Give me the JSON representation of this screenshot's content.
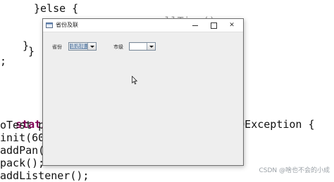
{
  "editor": {
    "lines": [
      {
        "text": "}else {"
      },
      {
        "text": "    ............allTime();"
      },
      {
        "text": "  }"
      },
      {
        "text": "}"
      },
      {
        "text": ";"
      },
      {
        "kw": "static",
        "text": "                            IOException {"
      },
      {
        "text": "oTest p"
      },
      {
        "text": "init(60"
      },
      {
        "text": "addPan("
      },
      {
        "text": "pack();"
      },
      {
        "text": "addListener();"
      }
    ]
  },
  "window": {
    "title": "省份及联",
    "controls": {
      "close": "✕"
    }
  },
  "form": {
    "province_label": "省份",
    "province_value": "请选择...",
    "city_label": "市级",
    "city_value": ""
  },
  "watermark": "CSDN @啥也不会的小成"
}
